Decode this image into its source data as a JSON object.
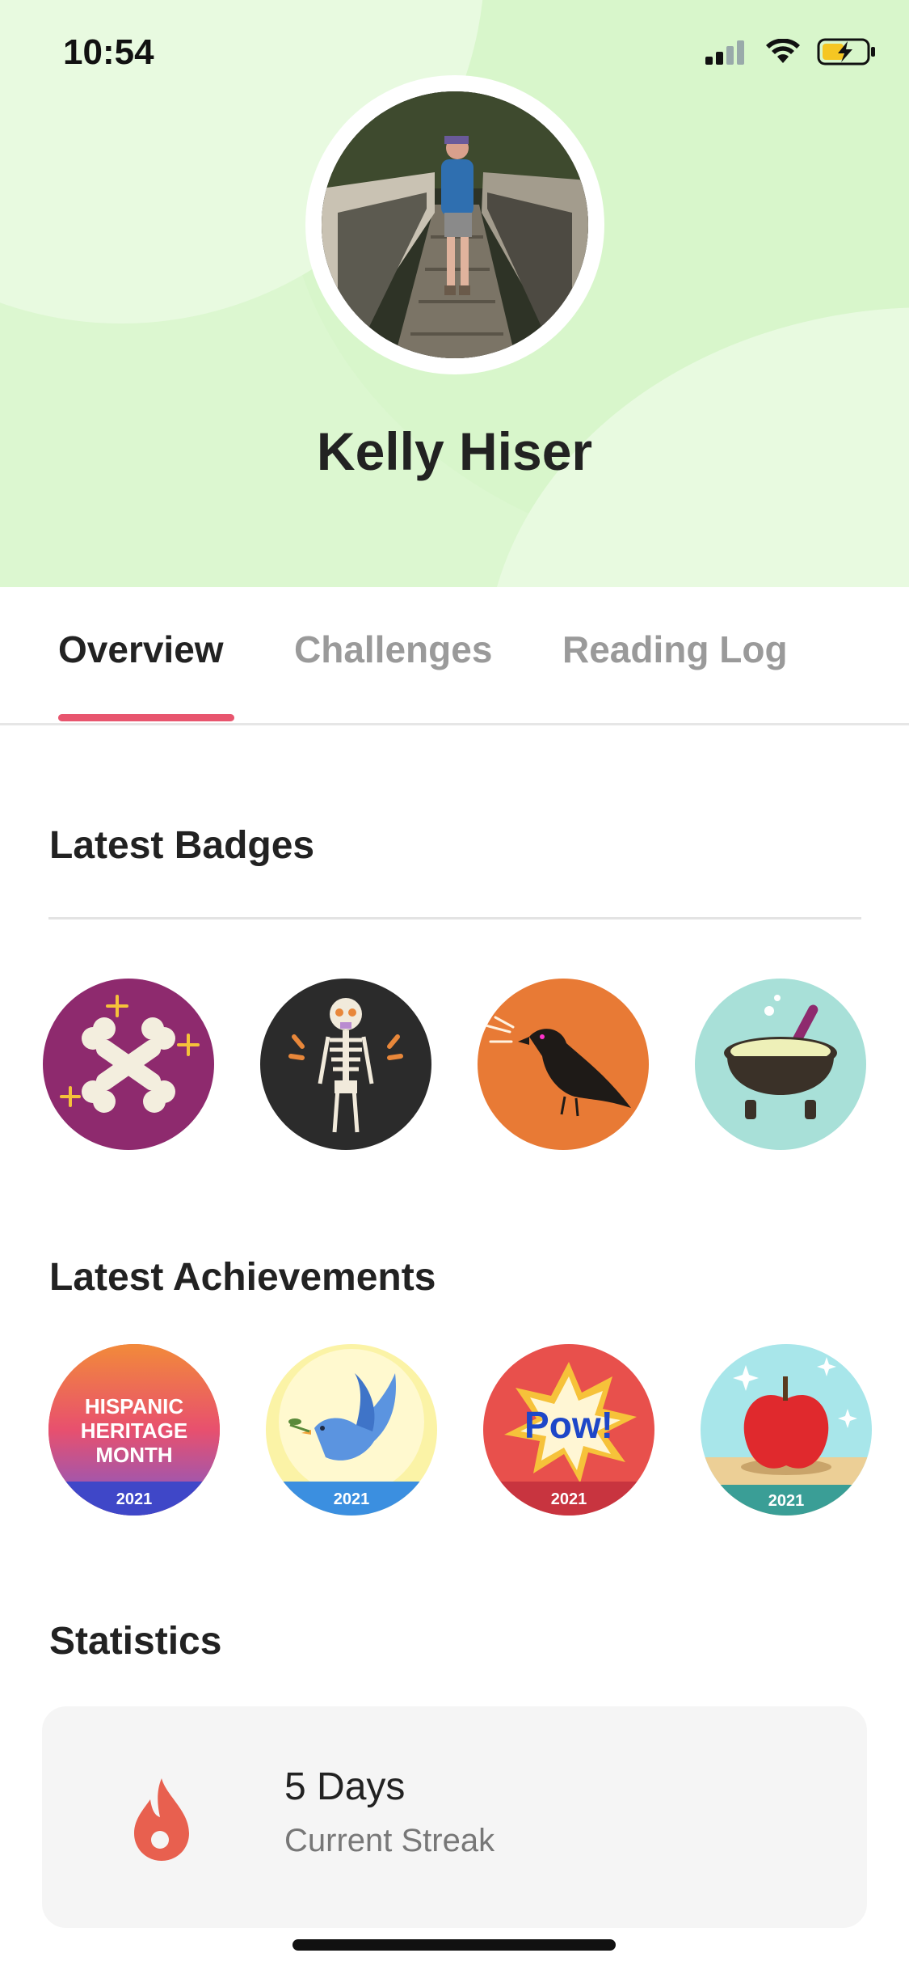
{
  "status_bar": {
    "time": "10:54"
  },
  "profile": {
    "name": "Kelly Hiser"
  },
  "tabs": [
    {
      "label": "Overview",
      "active": true
    },
    {
      "label": "Challenges",
      "active": false
    },
    {
      "label": "Reading Log",
      "active": false
    }
  ],
  "badges": {
    "title": "Latest Badges",
    "items": [
      {
        "icon": "crossed-bones-icon",
        "bg": "#8e2a6e"
      },
      {
        "icon": "skeleton-icon",
        "bg": "#2b2b2b"
      },
      {
        "icon": "crow-icon",
        "bg": "#e87a35"
      },
      {
        "icon": "cauldron-icon",
        "bg": "#a8e0d8"
      }
    ]
  },
  "achievements": {
    "title": "Latest Achievements",
    "items": [
      {
        "icon": "hispanic-heritage-month-icon",
        "text": "HISPANIC HERITAGE MONTH",
        "year": "2021"
      },
      {
        "icon": "dove-icon",
        "year": "2021"
      },
      {
        "icon": "pow-icon",
        "text": "Pow!",
        "year": "2021"
      },
      {
        "icon": "apple-icon",
        "year": "2021"
      }
    ]
  },
  "statistics": {
    "title": "Statistics",
    "streak_value": "5 Days",
    "streak_label": "Current Streak"
  },
  "colors": {
    "accent": "#e8556e",
    "header_bg": "#dcf7d0",
    "flame": "#e8604f"
  }
}
